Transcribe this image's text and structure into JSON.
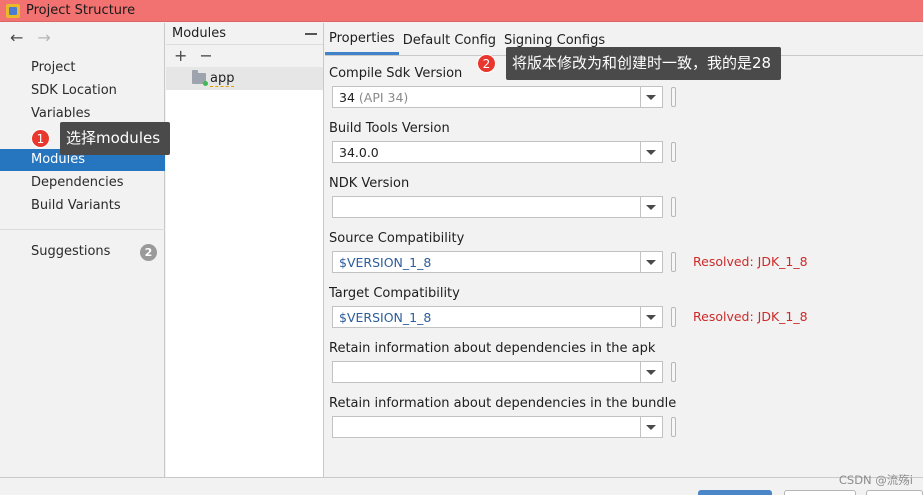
{
  "window": {
    "title": "Project Structure"
  },
  "nav": {
    "back": "←",
    "forward": "→",
    "items": [
      "Project",
      "SDK Location",
      "Variables",
      "Modules",
      "Dependencies",
      "Build Variants"
    ],
    "suggestions": "Suggestions",
    "suggestions_count": "2",
    "selected": "Modules"
  },
  "modules": {
    "title": "Modules",
    "add": "+",
    "remove": "−",
    "items": [
      "app"
    ]
  },
  "tabs": [
    "Properties",
    "Default Config",
    "Signing Configs"
  ],
  "form": {
    "compile_sdk": {
      "label": "Compile Sdk Version",
      "value": "34",
      "hint": "(API 34)"
    },
    "build_tools": {
      "label": "Build Tools Version",
      "value": "34.0.0"
    },
    "ndk": {
      "label": "NDK Version",
      "value": ""
    },
    "source_compat": {
      "label": "Source Compatibility",
      "value": "$VERSION_1_8",
      "resolved": "Resolved: JDK_1_8"
    },
    "target_compat": {
      "label": "Target Compatibility",
      "value": "$VERSION_1_8",
      "resolved": "Resolved: JDK_1_8"
    },
    "retain_apk": {
      "label": "Retain information about dependencies in the apk",
      "value": ""
    },
    "retain_bundle": {
      "label": "Retain information about dependencies in the bundle",
      "value": ""
    }
  },
  "annotations": [
    {
      "num": "1",
      "text": "选择modules"
    },
    {
      "num": "2",
      "text": "将版本修改为和创建时一致，我的是28"
    }
  ],
  "watermark": "CSDN @流殇i"
}
